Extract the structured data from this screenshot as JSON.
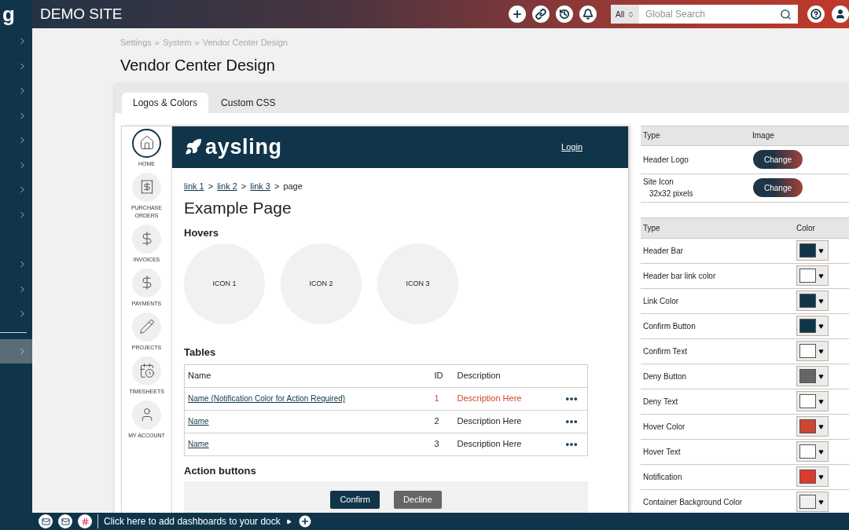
{
  "app_logo": "g",
  "site_title": "DEMO SITE",
  "search": {
    "scope": "All",
    "placeholder": "Global Search"
  },
  "sidebar": {
    "groups": [
      [
        {
          "selected": false
        },
        {
          "selected": false
        },
        {
          "selected": false
        },
        {
          "selected": false
        },
        {
          "selected": false
        },
        {
          "selected": false
        },
        {
          "selected": false
        },
        {
          "selected": false
        }
      ],
      [
        {
          "selected": false
        },
        {
          "selected": false
        },
        {
          "selected": false
        }
      ],
      [
        {
          "selected": true
        }
      ]
    ]
  },
  "breadcrumb": {
    "items": [
      "Settings",
      "System",
      "Vendor Center Design"
    ],
    "separator": "»"
  },
  "title": "Vendor Center Design",
  "tabs": [
    {
      "label": "Logos & Colors",
      "selected": true
    },
    {
      "label": "Custom CSS",
      "selected": false
    }
  ],
  "preview": {
    "nav": [
      {
        "label": "HOME",
        "kind": "home",
        "selected": true
      },
      {
        "label": "PURCHASE ORDERS",
        "kind": "receipt",
        "selected": false
      },
      {
        "label": "INVOICES",
        "kind": "dollar",
        "selected": false
      },
      {
        "label": "PAYMENTS",
        "kind": "dollar",
        "selected": false
      },
      {
        "label": "PROJECTS",
        "kind": "pencil",
        "selected": false
      },
      {
        "label": "TIMESHEETS",
        "kind": "timesheet",
        "selected": false
      },
      {
        "label": "MY ACCOUNT",
        "kind": "user",
        "selected": false
      }
    ],
    "logo_text": "aysling",
    "login": "Login",
    "crumbs": {
      "links": [
        "link 1",
        "link 2",
        "link 3"
      ],
      "separator": ">",
      "current": "page"
    },
    "heading": "Example Page",
    "hovers_title": "Hovers",
    "hovers": [
      "ICON 1",
      "ICON 2",
      "ICON 3"
    ],
    "tables_title": "Tables",
    "table": {
      "columns": [
        "Name",
        "ID",
        "Description"
      ],
      "rows": [
        {
          "name": "Name (Notification Color for Action Required)",
          "id": "1",
          "description": "Description Here",
          "alert": true
        },
        {
          "name": "Name",
          "id": "2",
          "description": "Description Here",
          "alert": false
        },
        {
          "name": "Name",
          "id": "3",
          "description": "Description Here",
          "alert": false
        }
      ]
    },
    "actions_title": "Action buttons",
    "confirm": "Confirm",
    "decline": "Decline"
  },
  "images": {
    "columns": [
      "Type",
      "Image"
    ],
    "rows": [
      {
        "type": "Header Logo",
        "button": "Change"
      },
      {
        "type": "Site Icon",
        "note": "32x32 pixels",
        "button": "Change"
      }
    ]
  },
  "colors": {
    "columns": [
      "Type",
      "Color"
    ],
    "rows": [
      {
        "type": "Header Bar",
        "color": "#10354a"
      },
      {
        "type": "Header bar link color",
        "color": "#ffffff"
      },
      {
        "type": "Link Color",
        "color": "#10354a"
      },
      {
        "type": "Confirm Button",
        "color": "#10354a"
      },
      {
        "type": "Confirm Text",
        "color": "#ffffff"
      },
      {
        "type": "Deny Button",
        "color": "#666666"
      },
      {
        "type": "Deny Text",
        "color": "#ffffff"
      },
      {
        "type": "Hover Color",
        "color": "#cc4433"
      },
      {
        "type": "Hover Text",
        "color": "#ffffff"
      },
      {
        "type": "Notification",
        "color": "#dd3b2e"
      },
      {
        "type": "Container Background Color",
        "color": "#f0f0f0"
      }
    ]
  },
  "dock": {
    "text": "Click here to add dashboards to your dock"
  }
}
